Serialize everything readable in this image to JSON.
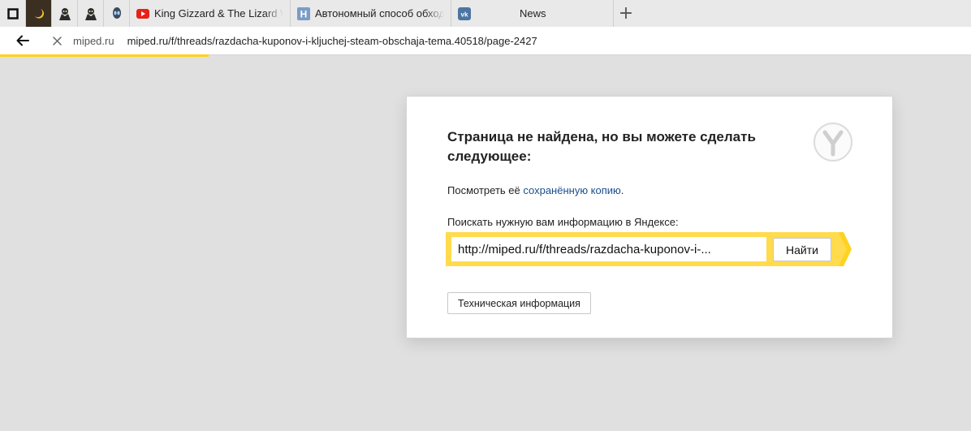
{
  "tabs": {
    "youtube_title": "King Gizzard & The Lizard W",
    "article_title": "Автономный способ обход",
    "vk_title": "News",
    "new_tab_symbol": "+"
  },
  "address": {
    "host": "miped.ru",
    "url": "miped.ru/f/threads/razdacha-kuponov-i-kljuchej-steam-obschaja-tema.40518/page-2427"
  },
  "error_page": {
    "title": "Страница не найдена, но вы можете сделать следующее:",
    "view_prefix": "Посмотреть её ",
    "view_link": "сохранённую копию",
    "view_suffix": ".",
    "search_prompt": "Поискать нужную вам информацию в Яндексе:",
    "search_value": "http://miped.ru/f/threads/razdacha-kuponov-i-...",
    "search_button": "Найти",
    "tech_button": "Техническая информация"
  },
  "colors": {
    "accent_yellow": "#ffd21f",
    "link": "#1a4e8c",
    "youtube_red": "#e62117",
    "vk_blue": "#4c75a3",
    "wiki_blue": "#7a9cc7"
  },
  "icons": {
    "tab1": "square-outline-icon",
    "tab2": "moon-icon",
    "tab3": "avatar-icon",
    "tab4": "avatar-icon",
    "tab5": "alien-icon",
    "tab6": "youtube-icon",
    "tab7": "n-letter-icon",
    "tab8": "vk-icon",
    "back": "arrow-left-icon",
    "stop": "close-icon",
    "brand": "yandex-browser-logo"
  }
}
